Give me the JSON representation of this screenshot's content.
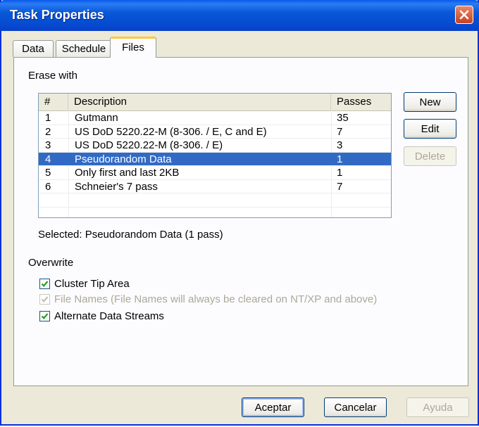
{
  "window": {
    "title": "Task Properties"
  },
  "tabs": [
    {
      "label": "Data"
    },
    {
      "label": "Schedule"
    },
    {
      "label": "Files",
      "active": true
    }
  ],
  "erase": {
    "label": "Erase with",
    "columns": [
      "#",
      "Description",
      "Passes"
    ],
    "rows": [
      {
        "num": "1",
        "description": "Gutmann",
        "passes": "35"
      },
      {
        "num": "2",
        "description": "US DoD 5220.22-M (8-306. / E, C and E)",
        "passes": "7"
      },
      {
        "num": "3",
        "description": "US DoD 5220.22-M (8-306. / E)",
        "passes": "3"
      },
      {
        "num": "4",
        "description": "Pseudorandom Data",
        "passes": "1",
        "selected": true
      },
      {
        "num": "5",
        "description": "Only first and last 2KB",
        "passes": "1"
      },
      {
        "num": "6",
        "description": "Schneier's 7 pass",
        "passes": "7"
      }
    ],
    "selected_text": "Selected: Pseudorandom Data (1 pass)"
  },
  "side_buttons": {
    "new": "New",
    "edit": "Edit",
    "delete": "Delete"
  },
  "overwrite": {
    "label": "Overwrite",
    "options": [
      {
        "label": "Cluster Tip Area",
        "checked": true,
        "disabled": false
      },
      {
        "label": "File Names (File Names will always be cleared on NT/XP and above)",
        "checked": true,
        "disabled": true
      },
      {
        "label": "Alternate Data Streams",
        "checked": true,
        "disabled": false
      }
    ]
  },
  "footer": {
    "accept": "Aceptar",
    "cancel": "Cancelar",
    "help": "Ayuda"
  },
  "colors": {
    "titlebar": "#0a58d8",
    "selection": "#316ac5",
    "dialog_bg": "#ece9d8",
    "close": "#c8411e",
    "checkmark": "#21a121"
  },
  "icons": {
    "close": "close-icon",
    "check": "checkmark-icon"
  }
}
